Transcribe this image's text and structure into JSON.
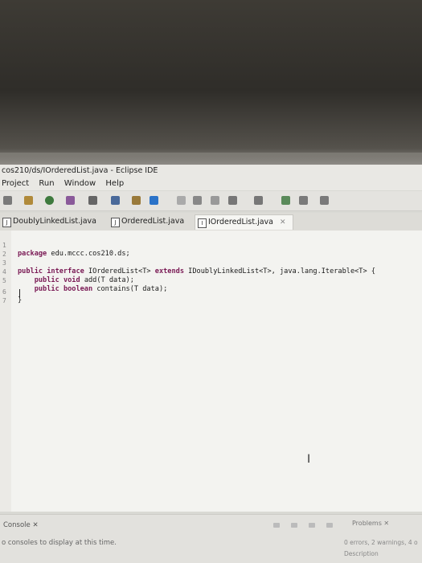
{
  "window": {
    "title": "cos210/ds/IOrderedList.java - Eclipse IDE"
  },
  "menu": [
    "Project",
    "Run",
    "Window",
    "Help"
  ],
  "tabs": [
    {
      "label": "DoublyLinkedList.java",
      "icon": "java-file-icon",
      "active": false
    },
    {
      "label": "OrderedList.java",
      "icon": "java-file-icon",
      "active": false
    },
    {
      "label": "IOrderedList.java",
      "icon": "java-interface-icon",
      "active": true,
      "close": "✕"
    }
  ],
  "editor": {
    "lines": [
      {
        "n": "1",
        "text": "package edu.mccc.cos210.ds;"
      },
      {
        "n": "2",
        "text": ""
      },
      {
        "n": "3",
        "text": "public interface IOrderedList<T> extends IDoublyLinkedList<T>, java.lang.Iterable<T> {"
      },
      {
        "n": "4",
        "text": "    public void add(T data);"
      },
      {
        "n": "5",
        "text": "    public boolean contains(T data);"
      },
      {
        "n": "6",
        "text": "}"
      },
      {
        "n": "7",
        "text": ""
      }
    ]
  },
  "bottom": {
    "console_label": "Console ✕",
    "console_message": "o consoles to display at this time.",
    "problems_label": "Problems ✕",
    "problems_count": "0 errors, 2 warnings, 4 o",
    "description_header": "Description"
  },
  "colors": {
    "keyword": "#7a1a55",
    "editor_bg": "#f3f3f0",
    "chrome_bg": "#e9e8e4"
  }
}
